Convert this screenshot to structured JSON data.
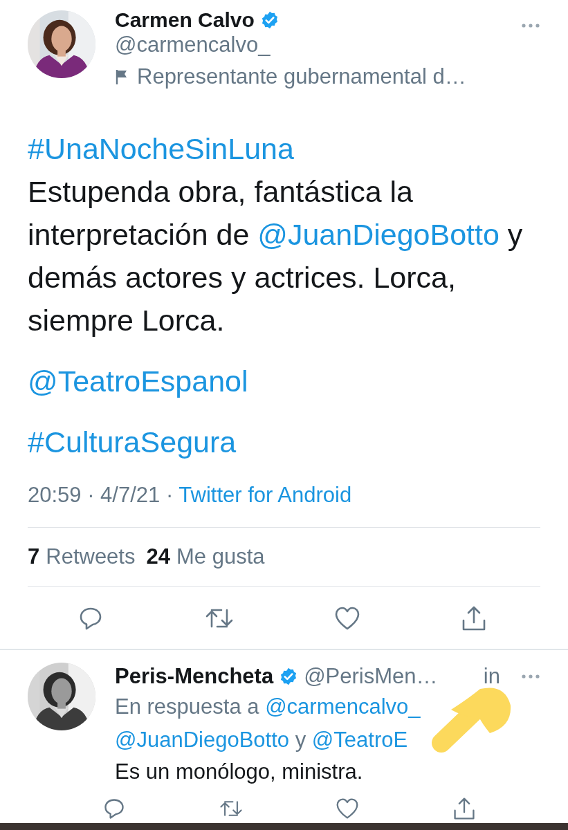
{
  "tweet": {
    "name": "Carmen Calvo",
    "verified": true,
    "handle": "@carmencalvo_",
    "label": "Representante gubernamental d…",
    "paragraphs": [
      {
        "segments": [
          {
            "kind": "link",
            "text": "#UnaNocheSinLuna"
          },
          {
            "kind": "break"
          },
          {
            "kind": "text",
            "text": "Estupenda obra, fantástica la interpretación de "
          },
          {
            "kind": "link",
            "text": "@JuanDiegoBotto"
          },
          {
            "kind": "text",
            "text": " y demás actores y actrices. Lorca, siempre Lorca."
          }
        ]
      },
      {
        "segments": [
          {
            "kind": "link",
            "text": "@TeatroEspanol"
          }
        ]
      },
      {
        "segments": [
          {
            "kind": "link",
            "text": "#CulturaSegura"
          }
        ]
      }
    ],
    "timestamp": "20:59 · 4/7/21 ·",
    "source": "Twitter for Android",
    "stats": [
      {
        "count": "7",
        "label": "Retweets"
      },
      {
        "count": "24",
        "label": "Me gusta"
      }
    ]
  },
  "reply": {
    "name": "Peris-Mencheta",
    "verified": true,
    "handle": "@PerisMen…",
    "time": "in",
    "context": [
      {
        "kind": "text",
        "text": "En respuesta a "
      },
      {
        "kind": "link",
        "text": "@carmencalvo_"
      },
      {
        "kind": "break"
      },
      {
        "kind": "link",
        "text": "@JuanDiegoBotto"
      },
      {
        "kind": "text",
        "text": " y "
      },
      {
        "kind": "link",
        "text": "@TeatroE"
      }
    ],
    "text": "Es un monólogo, ministra."
  }
}
